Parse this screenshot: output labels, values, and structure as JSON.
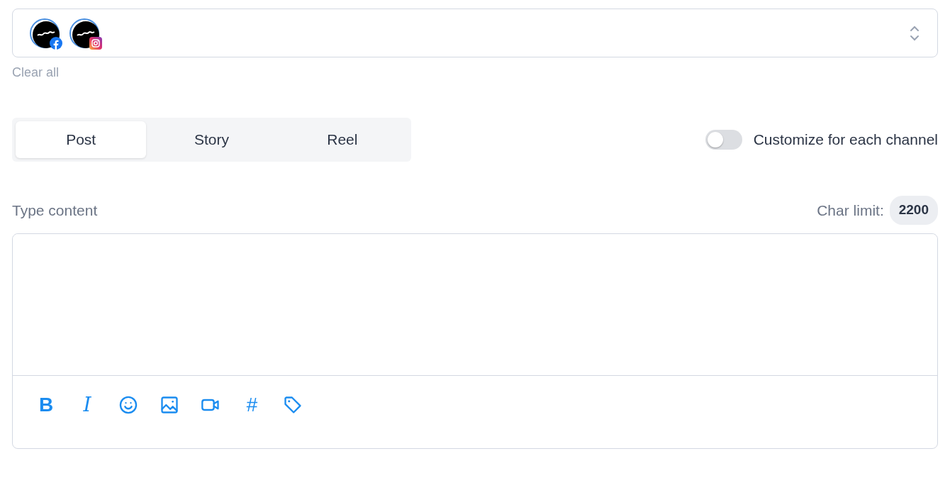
{
  "channels": [
    {
      "kind": "facebook",
      "selected": true
    },
    {
      "kind": "instagram",
      "selected": true
    }
  ],
  "clear_all": "Clear all",
  "tabs": [
    {
      "label": "Post",
      "selected": true
    },
    {
      "label": "Story",
      "selected": false
    },
    {
      "label": "Reel",
      "selected": false
    }
  ],
  "customize": {
    "label": "Customize for each channel",
    "on": false
  },
  "content": {
    "label": "Type content",
    "char_limit_label": "Char limit:",
    "char_limit": "2200"
  },
  "tools": [
    {
      "kind": "bold",
      "label": "B"
    },
    {
      "kind": "italic",
      "label": "I"
    },
    {
      "kind": "emoji"
    },
    {
      "kind": "image"
    },
    {
      "kind": "video"
    },
    {
      "kind": "hashtag",
      "label": "#"
    },
    {
      "kind": "tag"
    }
  ]
}
